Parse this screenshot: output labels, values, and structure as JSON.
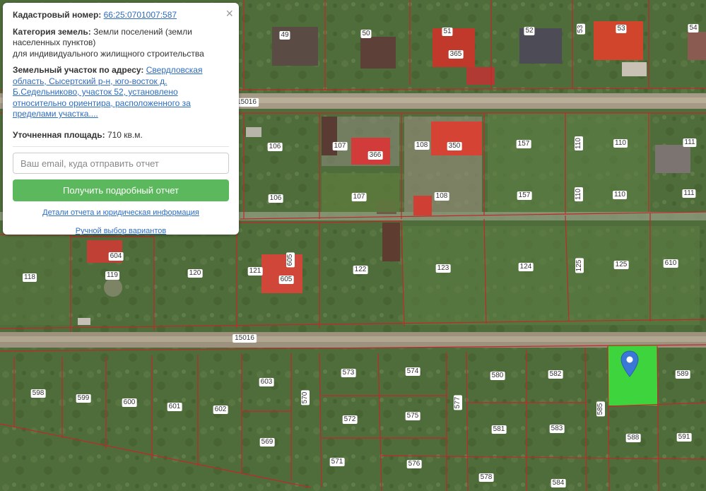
{
  "map": {
    "roads": [
      {
        "label": "15016"
      },
      {
        "label": "15016"
      }
    ],
    "plots": [
      "49",
      "50",
      "51",
      "365",
      "52",
      "53",
      "53",
      "54",
      "106",
      "107",
      "366",
      "108",
      "350",
      "157",
      "110",
      "110",
      "111",
      "106",
      "107",
      "108",
      "157",
      "110",
      "110",
      "111",
      "604",
      "119",
      "118",
      "120",
      "121",
      "605",
      "605",
      "122",
      "123",
      "124",
      "125",
      "125",
      "610",
      "598",
      "599",
      "600",
      "601",
      "602",
      "603",
      "570",
      "573",
      "574",
      "580",
      "582",
      "585",
      "589",
      "572",
      "575",
      "577",
      "581",
      "583",
      "588",
      "591",
      "569",
      "571",
      "576",
      "578",
      "584"
    ],
    "selected_plot_color": "#3dd43d",
    "boundary_color": "#c0282a"
  },
  "popup": {
    "cadastral_label": "Кадастровый номер:",
    "cadastral_number": "66:25:0701007:587",
    "category_label": "Категория земель:",
    "category_value": "Земли поселений (земли населенных пунктов)",
    "usage": "для индивидуального жилищного строительства",
    "address_label": "Земельный участок по адресу:",
    "address_value": "Свердловская область, Сысертский р-н, юго-восток д. Б.Седельниково, участок 52, установлено относительно ориентира, расположенного за пределами участка....",
    "area_label": "Уточненная площадь:",
    "area_value": "710 кв.м.",
    "email_placeholder": "Ваш email, куда отправить отчет",
    "get_report_button": "Получить подробный отчет",
    "details_link": "Детали отчета и юридическая информация",
    "manual_link": "Ручной выбор вариантов",
    "close_icon": "×"
  },
  "marker_icon": "map-pin-icon",
  "accent_color": "#5cb85c"
}
